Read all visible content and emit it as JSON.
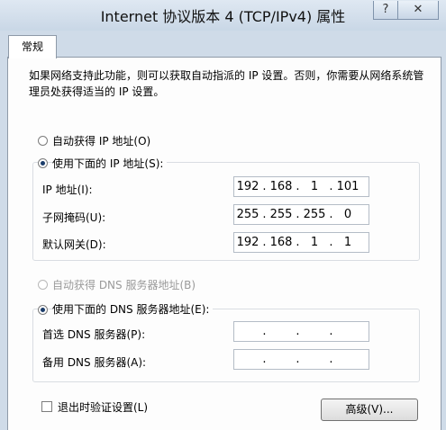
{
  "window": {
    "title": "Internet 协议版本 4 (TCP/IPv4) 属性",
    "help_glyph": "?",
    "close_glyph": "✕"
  },
  "tabs": [
    {
      "label": "常规"
    }
  ],
  "description": "如果网络支持此功能，则可以获取自动指派的 IP 设置。否则，你需要从网络系统管理员处获得适当的 IP 设置。",
  "ip": {
    "auto_label": "自动获得 IP 地址(O)",
    "manual_label": "使用下面的 IP 地址(S):",
    "selected": "manual",
    "fields": [
      {
        "label": "IP 地址(I):",
        "octets": [
          "192",
          "168",
          "1",
          "101"
        ]
      },
      {
        "label": "子网掩码(U):",
        "octets": [
          "255",
          "255",
          "255",
          "0"
        ]
      },
      {
        "label": "默认网关(D):",
        "octets": [
          "192",
          "168",
          "1",
          "1"
        ]
      }
    ]
  },
  "dns": {
    "auto_label": "自动获得 DNS 服务器地址(B)",
    "manual_label": "使用下面的 DNS 服务器地址(E):",
    "selected": "manual",
    "fields": [
      {
        "label": "首选 DNS 服务器(P):",
        "octets": [
          "",
          "",
          "",
          ""
        ]
      },
      {
        "label": "备用 DNS 服务器(A):",
        "octets": [
          "",
          "",
          "",
          ""
        ]
      }
    ]
  },
  "validate_label": "退出时验证设置(L)",
  "advanced_label": "高级(V)..."
}
